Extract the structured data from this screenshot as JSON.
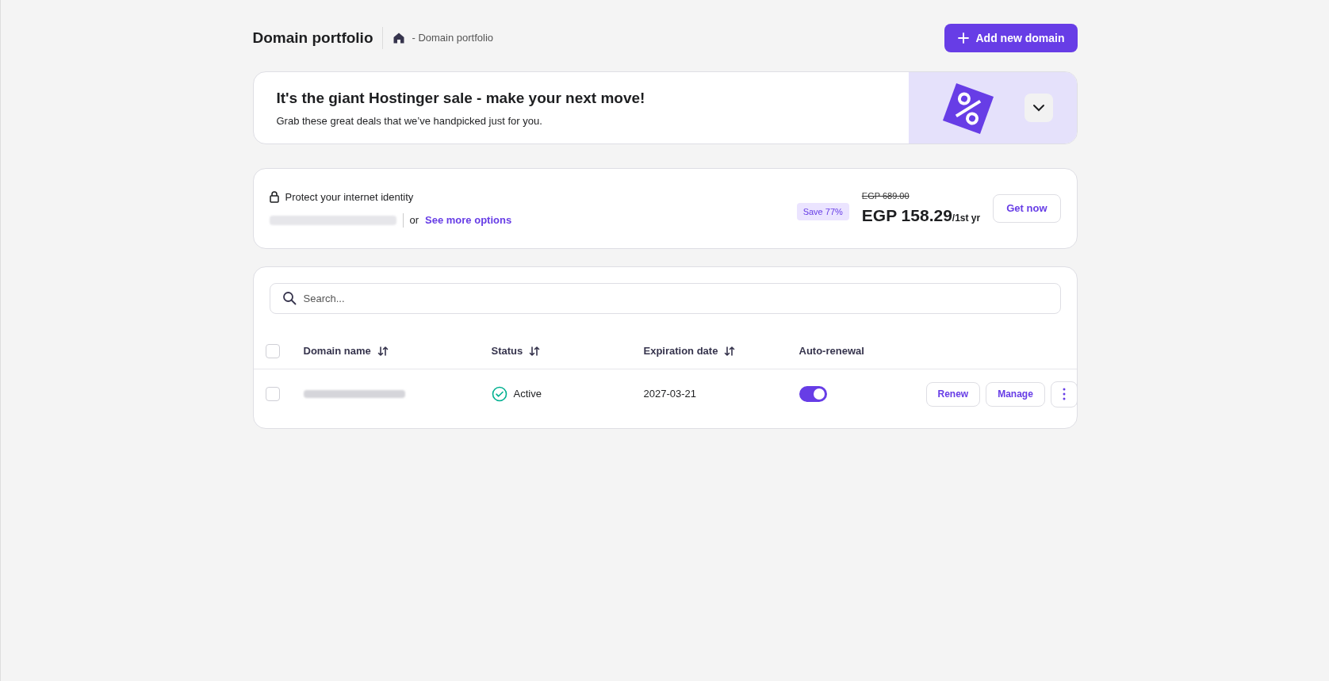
{
  "header": {
    "title": "Domain portfolio",
    "breadcrumb": "- Domain portfolio",
    "add_button": "Add new domain"
  },
  "sale_banner": {
    "title": "It's the giant Hostinger sale - make your next move!",
    "subtitle": "Grab these great deals that we’ve handpicked just for you.",
    "expanded": false
  },
  "offer": {
    "title": "Protect your internet identity",
    "or": "or",
    "link": "See more options",
    "save_badge": "Save 77%",
    "old_price": "EGP 689.00",
    "price": "EGP 158.29",
    "period": "/1st yr",
    "button": "Get now"
  },
  "search": {
    "placeholder": "Search..."
  },
  "table": {
    "select_all": false,
    "columns": [
      {
        "label": "Domain name",
        "sortable": true
      },
      {
        "label": "Status",
        "sortable": true
      },
      {
        "label": "Expiration date",
        "sortable": true
      },
      {
        "label": "Auto-renewal",
        "sortable": false
      }
    ],
    "rows": [
      {
        "checked": false,
        "status": "Active",
        "expiration": "2027-03-21",
        "auto_renewal": true,
        "renew": "Renew",
        "manage": "Manage"
      }
    ]
  }
}
